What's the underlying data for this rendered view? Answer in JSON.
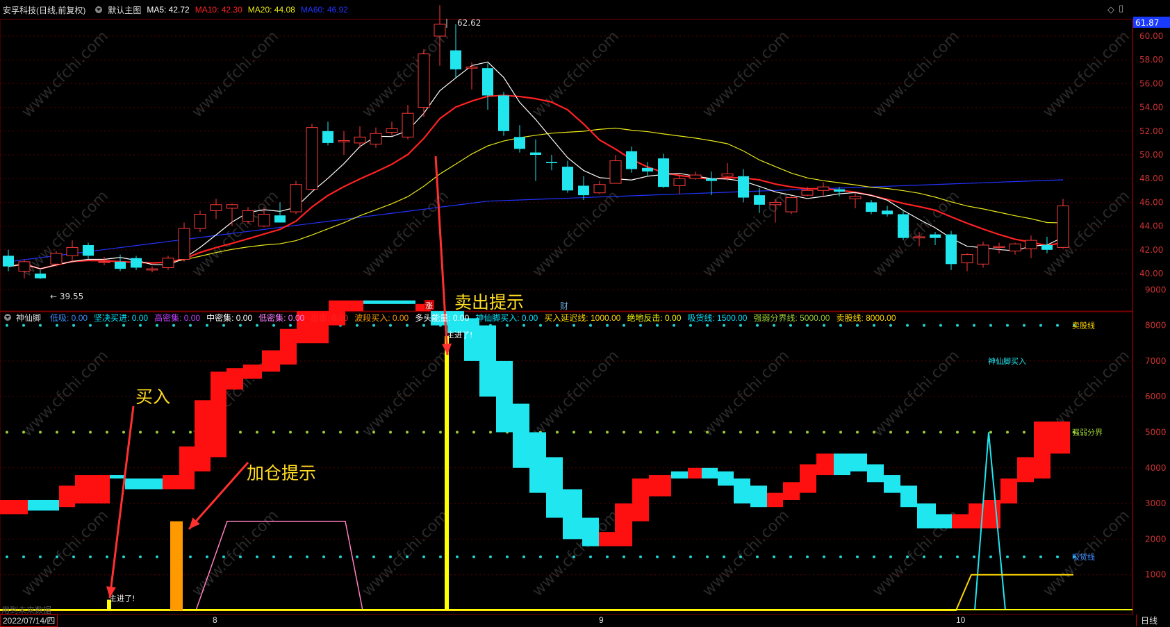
{
  "header": {
    "stock_title": "安孚科技(日线,前复权)",
    "main_chart": "默认主图",
    "ma5": "MA5: 42.72",
    "ma10": "MA10: 42.30",
    "ma20": "MA20: 44.08",
    "ma60": "MA60: 46.92",
    "colors": {
      "ma5": "#ffffff",
      "ma10": "#ff2222",
      "ma20": "#e8e81a",
      "ma60": "#2233ff"
    }
  },
  "price_axis": {
    "current_price": "61.87",
    "ticks": [
      "60.00",
      "58.00",
      "56.00",
      "54.00",
      "52.00",
      "50.00",
      "48.00",
      "46.00",
      "44.00",
      "42.00",
      "40.00"
    ]
  },
  "price_annotations": {
    "high": "62.62",
    "low": "39.55"
  },
  "markers": {
    "zhang": "涨",
    "cai": "财"
  },
  "indicator": {
    "name": "神仙脚",
    "items": [
      {
        "label": "低吸: 0.00",
        "color": "#3a8cff"
      },
      {
        "label": "坚决买进: 0.00",
        "color": "#00e5ff"
      },
      {
        "label": "高密集: 0.00",
        "color": "#c040ff"
      },
      {
        "label": "中密集: 0.00",
        "color": "#ffffff"
      },
      {
        "label": "低密集: 0.00",
        "color": "#ff80ff"
      },
      {
        "label": "出击: 0.00",
        "color": "#ff2222"
      },
      {
        "label": "波段买入: 0.00",
        "color": "#ff9900"
      },
      {
        "label": "多头能量: 0.00",
        "color": "#ffffff"
      },
      {
        "label": "神仙脚买入: 0.00",
        "color": "#00e5ff"
      },
      {
        "label": "买入延迟线: 1000.00",
        "color": "#ffd700"
      },
      {
        "label": "绝地反击: 0.00",
        "color": "#ffff00"
      },
      {
        "label": "吸货线: 1500.00",
        "color": "#00e5ff"
      },
      {
        "label": "强弱分界线: 5000.00",
        "color": "#9acd32"
      },
      {
        "label": "卖股线: 8000.00",
        "color": "#ffd700"
      }
    ],
    "axis_ticks": [
      "9000",
      "8000",
      "7000",
      "6000",
      "5000",
      "4000",
      "3000",
      "2000",
      "1000"
    ],
    "right_labels": {
      "sell": "卖股线",
      "strong": "强弱分界",
      "absorb": "吸货线",
      "shenxian": "神仙脚买入"
    },
    "in_chart_text": {
      "zhu1": "主进了!",
      "zhu2": "主进了!"
    }
  },
  "annotations": {
    "buy": "买入",
    "add": "加仓提示",
    "sell": "卖出提示"
  },
  "footer": {
    "date": "2022/07/14/四",
    "months": [
      "8",
      "9",
      "10"
    ],
    "period": "日线",
    "faded": "用到未来数据"
  },
  "watermark": "www.cfchi.com"
}
